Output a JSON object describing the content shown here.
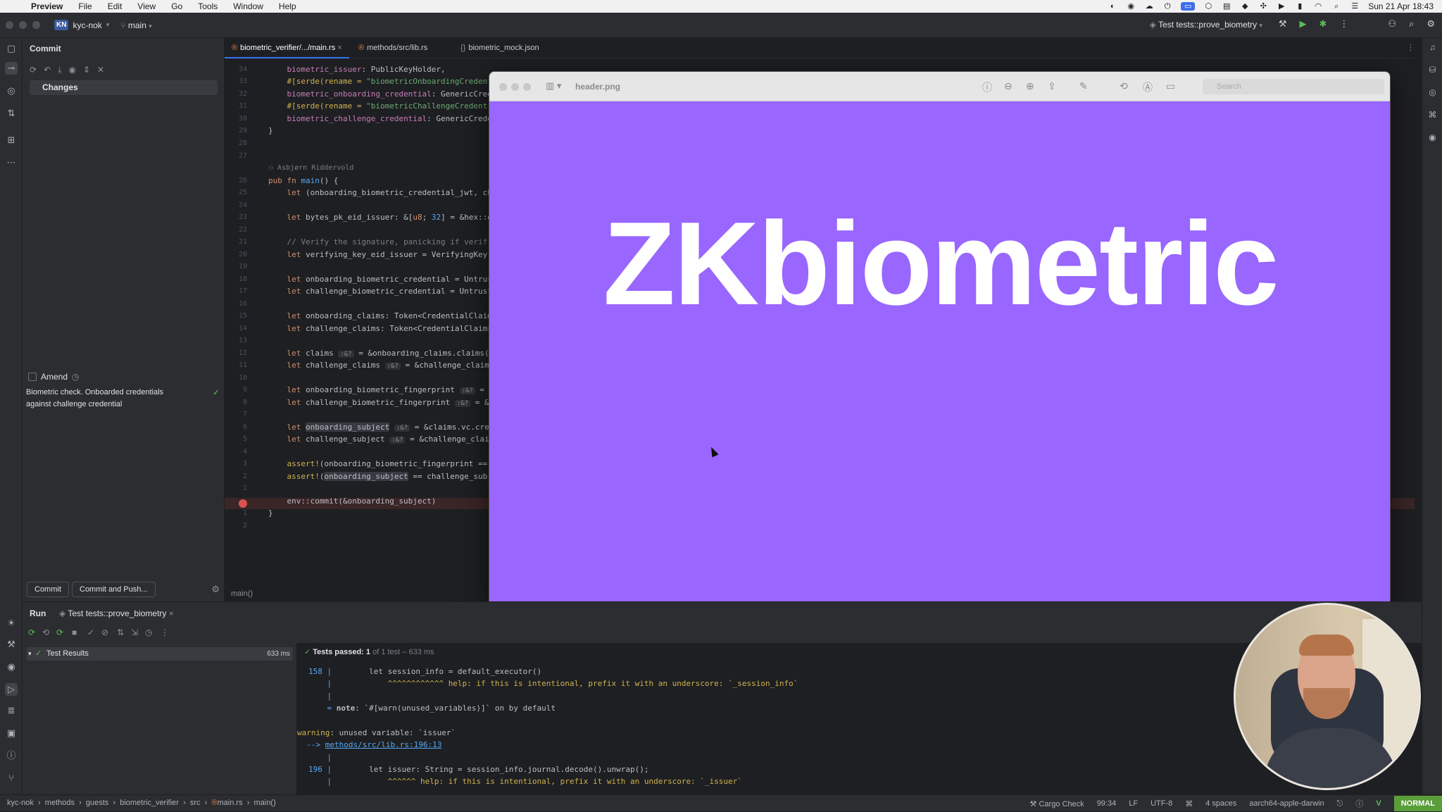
{
  "menubar": {
    "app": "Preview",
    "items": [
      "File",
      "Edit",
      "View",
      "Go",
      "Tools",
      "Window",
      "Help"
    ],
    "clock": "Sun 21 Apr 18:43"
  },
  "titlebar": {
    "project_badge": "KN",
    "project": "kyc-nok",
    "branch": "main",
    "run_config": "Test tests::prove_biometry"
  },
  "commit_panel": {
    "title": "Commit",
    "changes_label": "Changes",
    "amend_label": "Amend",
    "message_line1": "Biometric check. Onboarded credentials",
    "message_line2": "against challenge credential",
    "commit_button": "Commit",
    "commit_push_button": "Commit and Push..."
  },
  "editor": {
    "tabs": [
      "biometric_verifier/.../main.rs",
      "methods/src/lib.rs",
      "biometric_mock.json"
    ],
    "author": "Asbjørn Riddervold",
    "footer_fn": "main()",
    "line_numbers": [
      "34",
      "33",
      "32",
      "31",
      "30",
      "29",
      "28",
      "27",
      "",
      "26",
      "25",
      "24",
      "23",
      "22",
      "21",
      "20",
      "19",
      "18",
      "17",
      "16",
      "15",
      "14",
      "13",
      "12",
      "11",
      "10",
      "9",
      "8",
      "7",
      "6",
      "5",
      "4",
      "3",
      "2",
      "1",
      "",
      "1",
      "2"
    ]
  },
  "preview": {
    "filename": "header.png",
    "search_placeholder": "Search",
    "image_text": "ZKbiometric",
    "bg_color": "#9966ff"
  },
  "run": {
    "title": "Run",
    "tab": "Test tests::prove_biometry",
    "result_label": "Test Results",
    "result_time": "633 ms",
    "passed_label": "Tests passed:",
    "passed_count": "1",
    "passed_detail": "of 1 test – 633 ms",
    "console": {
      "l1_num": "158",
      "l1_code": "        let session_info = default_executor()",
      "l2": "            ^^^^^^^^^^^^ help: if this is intentional, prefix it with an underscore: `_session_info`",
      "l4_label": "note",
      "l4": ": `#[warn(unused_variables)]` on by default",
      "l5_label": "warning",
      "l5": ": unused variable: `issuer`",
      "l6_arrow": "  -->",
      "l6_link": "methods/src/lib.rs:196:13",
      "l8_num": "196",
      "l8_code": "        let issuer: String = session_info.journal.decode().unwrap();",
      "l9": "            ^^^^^^ help: if this is intentional, prefix it with an underscore: `_issuer`"
    }
  },
  "statusbar": {
    "crumbs": [
      "kyc-nok",
      "methods",
      "guests",
      "biometric_verifier",
      "src",
      "main.rs",
      "main()"
    ],
    "cargo": "Cargo Check",
    "position": "99:34",
    "line_ending": "LF",
    "encoding": "UTF-8",
    "indent": "4 spaces",
    "target": "aarch64-apple-darwin",
    "mode": "NORMAL"
  }
}
